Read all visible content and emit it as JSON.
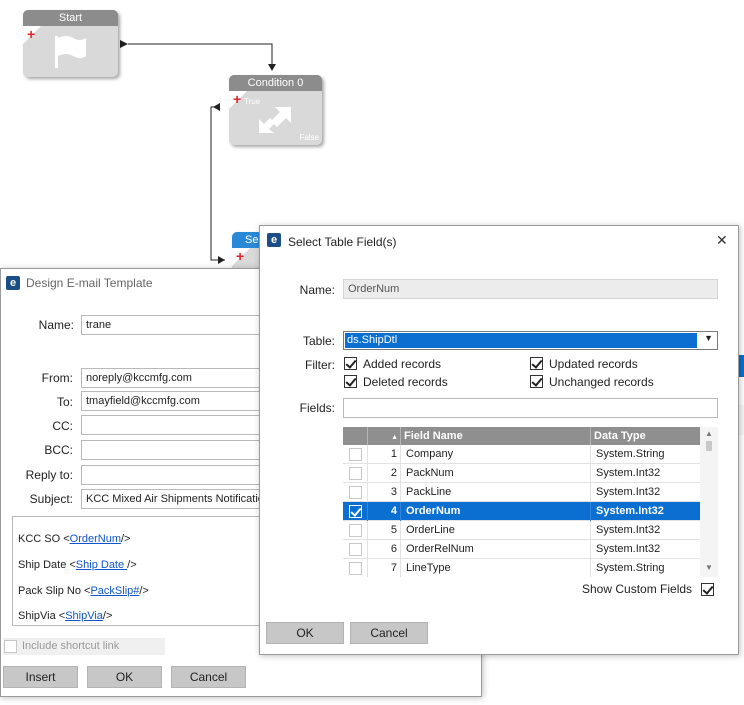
{
  "workflow": {
    "start": {
      "title": "Start"
    },
    "condition": {
      "title": "Condition 0",
      "true_label": "True",
      "false_label": "False"
    },
    "partial_node": {
      "title": "Se"
    }
  },
  "email_dialog": {
    "title": "Design E-mail Template",
    "name_label": "Name:",
    "name_value": "trane",
    "from_label": "From:",
    "from_value": "noreply@kccmfg.com",
    "to_label": "To:",
    "to_value": "tmayfield@kccmfg.com",
    "cc_label": "CC:",
    "cc_value": "",
    "bcc_label": "BCC:",
    "bcc_value": "",
    "replyto_label": "Reply to:",
    "replyto_value": "",
    "subject_label": "Subject:",
    "subject_value": "KCC Mixed Air Shipments Notification",
    "body": [
      {
        "prefix": "KCC SO <",
        "link": "OrderNum",
        "suffix": "/>"
      },
      {
        "prefix": "Ship Date <",
        "link": "Ship Date ",
        "suffix": "/>"
      },
      {
        "prefix": "Pack Slip No <",
        "link": "PackSlip#",
        "suffix": "/>"
      },
      {
        "prefix": "ShipVia <",
        "link": "ShipVia",
        "suffix": "/>"
      }
    ],
    "include_shortcut_label": "Include shortcut link",
    "insert_label": "Insert",
    "ok_label": "OK",
    "cancel_label": "Cancel"
  },
  "field_dialog": {
    "title": "Select Table Field(s)",
    "close_glyph": "✕",
    "name_label": "Name:",
    "name_value": "OrderNum",
    "table_label": "Table:",
    "table_value": "ds.ShipDtl",
    "filter_label": "Filter:",
    "filters": {
      "added": {
        "label": "Added records",
        "checked": true
      },
      "deleted": {
        "label": "Deleted records",
        "checked": true
      },
      "updated": {
        "label": "Updated records",
        "checked": true
      },
      "unchanged": {
        "label": "Unchanged records",
        "checked": true
      }
    },
    "fields_label": "Fields:",
    "fields_search": "",
    "grid": {
      "sort_glyph": "▲",
      "col_field_name": "Field Name",
      "col_data_type": "Data Type",
      "rows": [
        {
          "n": "1",
          "name": "Company",
          "type": "System.String",
          "checked": false,
          "selected": false
        },
        {
          "n": "2",
          "name": "PackNum",
          "type": "System.Int32",
          "checked": false,
          "selected": false
        },
        {
          "n": "3",
          "name": "PackLine",
          "type": "System.Int32",
          "checked": false,
          "selected": false
        },
        {
          "n": "4",
          "name": "OrderNum",
          "type": "System.Int32",
          "checked": true,
          "selected": true
        },
        {
          "n": "5",
          "name": "OrderLine",
          "type": "System.Int32",
          "checked": false,
          "selected": false
        },
        {
          "n": "6",
          "name": "OrderRelNum",
          "type": "System.Int32",
          "checked": false,
          "selected": false
        },
        {
          "n": "7",
          "name": "LineType",
          "type": "System.String",
          "checked": false,
          "selected": false
        }
      ]
    },
    "show_custom_label": "Show Custom Fields",
    "show_custom_checked": true,
    "ok_label": "OK",
    "cancel_label": "Cancel"
  }
}
